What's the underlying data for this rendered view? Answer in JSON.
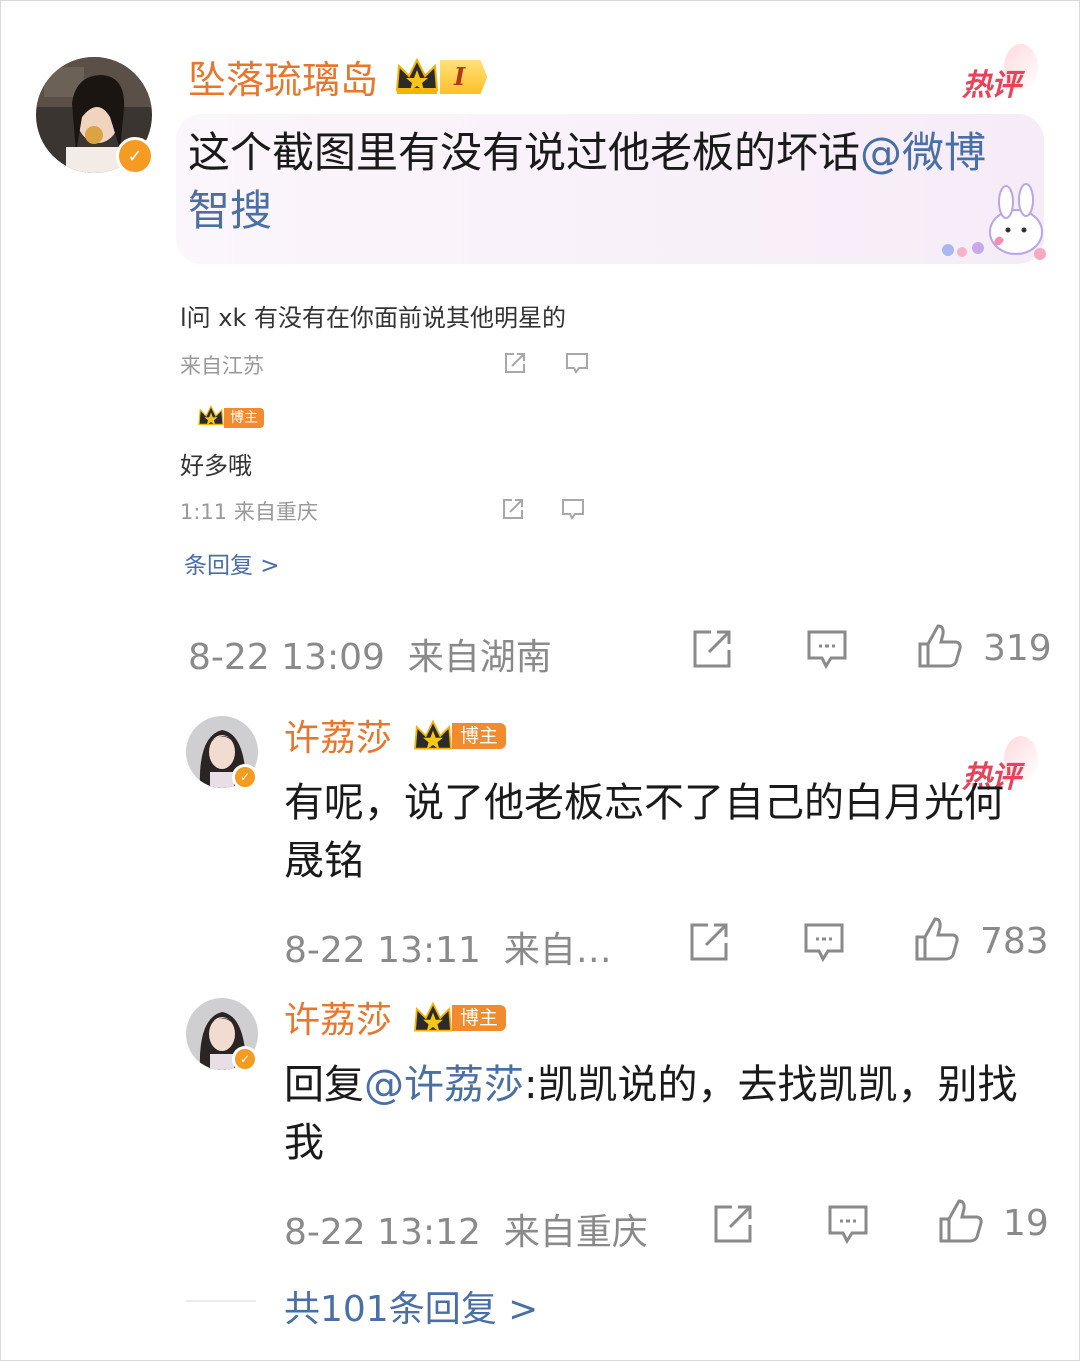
{
  "comment": {
    "author": "坠落琉璃岛",
    "level_badge": "I",
    "hot_label": "热评",
    "text": "这个截图里有没有说过他老板的坏话",
    "mention": "@微博智搜",
    "time": "8-22 13:09",
    "location": "来自湖南",
    "likes": "319"
  },
  "screenshot": {
    "line1_text": "l问 xk 有没有在你面前说其他明星的",
    "line1_meta": "来自江苏",
    "line2_badge": "博主",
    "line2_text": "好多哦",
    "line2_meta": "1:11 来自重庆",
    "replies_link": "条回复 >"
  },
  "reply1": {
    "author": "许荔莎",
    "badge": "博主",
    "hot_label": "热评",
    "text": "有呢，说了他老板忘不了自己的白月光何晟铭",
    "time": "8-22 13:11",
    "location": "来自…",
    "likes": "783"
  },
  "reply2": {
    "author": "许荔莎",
    "badge": "博主",
    "prefix": "回复",
    "mention": "@许荔莎",
    "text": ":凯凯说的，去找凯凯，别找我",
    "time": "8-22 13:12",
    "location": "来自重庆",
    "likes": "19"
  },
  "more_replies": "共101条回复 >",
  "colors": {
    "name": "#e8772e",
    "link": "#4a6fa5",
    "meta": "#8a8a8a",
    "hot": "#e8435a",
    "verified": "#f59b22"
  }
}
